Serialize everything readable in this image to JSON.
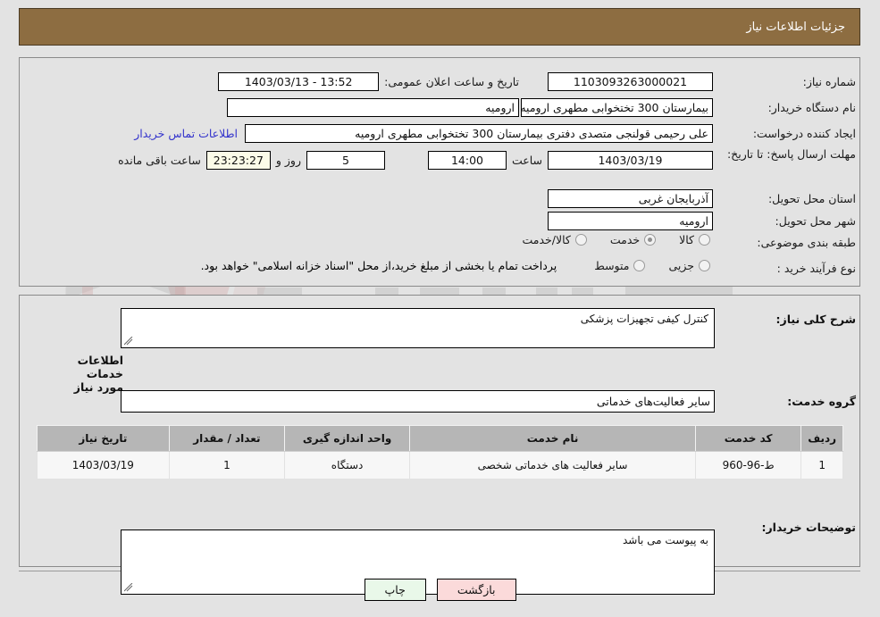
{
  "header": {
    "title": "جزئیات اطلاعات نیاز"
  },
  "form": {
    "need_number_label": "شماره نیاز:",
    "need_number_value": "1103093263000021",
    "announce_label": "تاریخ و ساعت اعلان عمومی:",
    "announce_value": "13:52 - 1403/03/13",
    "buyer_org_label": "نام دستگاه خریدار:",
    "buyer_org_value": "بیمارستان 300 تختخوابی مطهری  ارومیه",
    "buyer_org_value2": "ارومیه",
    "creator_label": "ایجاد کننده درخواست:",
    "creator_value": "علی رحیمی قولنجی متصدی دفتری بیمارستان 300 تختخوابی مطهری  ارومیه",
    "contact_link": "اطلاعات تماس خریدار",
    "deadline_label": "مهلت ارسال پاسخ: تا تاریخ:",
    "deadline_date": "1403/03/19",
    "hour_label": "ساعت",
    "deadline_time": "14:00",
    "days_value": "5",
    "days_label": "روز و",
    "countdown_value": "23:23:27",
    "countdown_label": "ساعت باقی مانده",
    "province_label": "استان محل تحویل:",
    "province_value": "آذربایجان غربی",
    "city_label": "شهر محل تحویل:",
    "city_value": "ارومیه",
    "category_label": "طبقه بندی موضوعی:",
    "category_options": [
      {
        "label": "کالا",
        "selected": false
      },
      {
        "label": "خدمت",
        "selected": true
      },
      {
        "label": "کالا/خدمت",
        "selected": false
      }
    ],
    "process_label": "نوع فرآیند خرید :",
    "process_options": [
      {
        "label": "جزیی",
        "selected": false
      },
      {
        "label": "متوسط",
        "selected": false
      }
    ],
    "payment_note": "پرداخت تمام یا بخشی از مبلغ خرید،از محل \"اسناد خزانه اسلامی\" خواهد بود."
  },
  "details": {
    "overview_label": "شرح کلی نیاز:",
    "overview_value": "کنترل کیفی تجهیزات پزشکی",
    "services_heading": "اطلاعات خدمات مورد نیاز",
    "service_group_label": "گروه خدمت:",
    "service_group_value": "سایر فعالیت‌های خدماتی",
    "notes_label": "توضیحات خریدار:",
    "notes_value": "به پیوست می باشد"
  },
  "table": {
    "columns": [
      "ردیف",
      "کد خدمت",
      "نام خدمت",
      "واحد اندازه گیری",
      "تعداد / مقدار",
      "تاریخ نیاز"
    ],
    "rows": [
      {
        "radif": "1",
        "code": "ط-96-960",
        "name": "سایر فعالیت های خدماتی شخصی",
        "unit": "دستگاه",
        "qty": "1",
        "date": "1403/03/19"
      }
    ]
  },
  "footer": {
    "print_label": "چاپ",
    "back_label": "بازگشت"
  }
}
